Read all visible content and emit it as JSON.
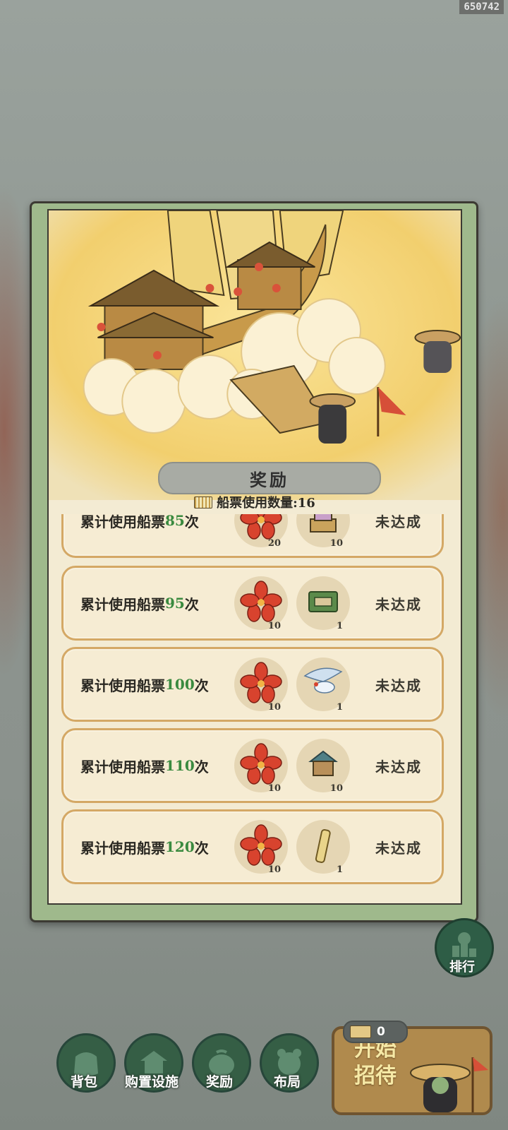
{
  "watermark": "650742",
  "panel": {
    "title": "奖励",
    "ticket_count_label": "船票使用数量:16"
  },
  "rewards": [
    {
      "prefix": "累计使用船票",
      "count": "85",
      "suffix": "次",
      "items": [
        {
          "icon": "red-flower-icon",
          "qty": "20"
        },
        {
          "icon": "furniture-item-icon",
          "qty": "10"
        }
      ],
      "status": "未达成"
    },
    {
      "prefix": "累计使用船票",
      "count": "95",
      "suffix": "次",
      "items": [
        {
          "icon": "red-flower-icon",
          "qty": "10"
        },
        {
          "icon": "ticket-voucher-icon",
          "qty": "1"
        }
      ],
      "status": "未达成"
    },
    {
      "prefix": "累计使用船票",
      "count": "100",
      "suffix": "次",
      "items": [
        {
          "icon": "red-flower-icon",
          "qty": "10"
        },
        {
          "icon": "crane-bird-icon",
          "qty": "1"
        }
      ],
      "status": "未达成"
    },
    {
      "prefix": "累计使用船票",
      "count": "110",
      "suffix": "次",
      "items": [
        {
          "icon": "red-flower-icon",
          "qty": "10"
        },
        {
          "icon": "building-piece-icon",
          "qty": "10"
        }
      ],
      "status": "未达成"
    },
    {
      "prefix": "累计使用船票",
      "count": "120",
      "suffix": "次",
      "items": [
        {
          "icon": "red-flower-icon",
          "qty": "10"
        },
        {
          "icon": "scroll-icon",
          "qty": "1"
        }
      ],
      "status": "未达成"
    }
  ],
  "ranking": {
    "label": "排行",
    "icon": "ranking-icon"
  },
  "nav": [
    {
      "label": "背包",
      "icon": "bag-icon"
    },
    {
      "label": "购置设施",
      "icon": "shop-icon"
    },
    {
      "label": "奖励",
      "icon": "gift-icon"
    },
    {
      "label": "布局",
      "icon": "layout-icon"
    }
  ],
  "tickets": {
    "value": "0"
  },
  "start_button": {
    "label": "开始招待"
  }
}
